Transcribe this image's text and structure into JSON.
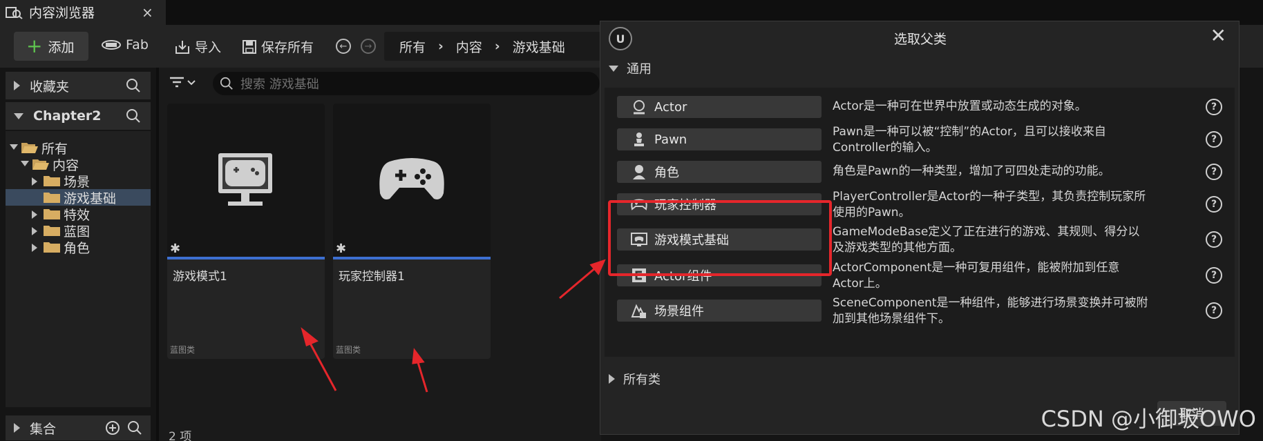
{
  "tab": {
    "title": "内容浏览器",
    "close": "×"
  },
  "toolbar": {
    "add_label": "添加",
    "fab_label": "Fab",
    "import_label": "导入",
    "save_all_label": "保存所有",
    "breadcrumb": [
      "所有",
      "内容",
      "游戏基础"
    ]
  },
  "sidebar": {
    "favorites": "收藏夹",
    "project": "Chapter2",
    "tree": [
      {
        "label": "所有",
        "level": 0,
        "expanded": true,
        "selected": false
      },
      {
        "label": "内容",
        "level": 1,
        "expanded": true,
        "selected": false
      },
      {
        "label": "场景",
        "level": 2,
        "expanded": false,
        "selected": false
      },
      {
        "label": "游戏基础",
        "level": 2,
        "expanded": false,
        "selected": true
      },
      {
        "label": "特效",
        "level": 2,
        "expanded": false,
        "selected": false
      },
      {
        "label": "蓝图",
        "level": 2,
        "expanded": false,
        "selected": false
      },
      {
        "label": "角色",
        "level": 2,
        "expanded": false,
        "selected": false
      }
    ],
    "collections": "集合"
  },
  "content": {
    "search_placeholder": "搜索 游戏基础",
    "assets": [
      {
        "name": "游戏模式1",
        "type": "蓝图类",
        "icon": "monitor-gamepad-icon"
      },
      {
        "name": "玩家控制器1",
        "type": "蓝图类",
        "icon": "gamepad-icon"
      }
    ],
    "item_count": "2 项"
  },
  "dialog": {
    "title": "选取父类",
    "common_section": "通用",
    "all_classes_section": "所有类",
    "cancel_label": "取消",
    "classes": [
      {
        "label": "Actor",
        "icon": "actor-icon",
        "desc_lines": [
          "Actor是一种可在世界中放置或动态生成的对象。"
        ]
      },
      {
        "label": "Pawn",
        "icon": "pawn-icon",
        "desc_lines": [
          "Pawn是一种可以被“控制”的Actor，且可以接收来自",
          "Controller的输入。"
        ]
      },
      {
        "label": "角色",
        "icon": "character-icon",
        "desc_lines": [
          "角色是Pawn的一种类型，增加了可四处走动的功能。"
        ]
      },
      {
        "label": "玩家控制器",
        "icon": "gamepad-icon",
        "desc_lines": [
          "PlayerController是Actor的一种子类型，其负责控制玩家所",
          "使用的Pawn。"
        ]
      },
      {
        "label": "游戏模式基础",
        "icon": "monitor-gamepad-icon",
        "desc_lines": [
          "GameModeBase定义了正在进行的游戏、其规则、得分以",
          "及游戏类型的其他方面。"
        ]
      },
      {
        "label": "Actor组件",
        "icon": "component-icon",
        "desc_lines": [
          "ActorComponent是一种可复用组件，能被附加到任意",
          "Actor上。"
        ]
      },
      {
        "label": "场景组件",
        "icon": "scene-component-icon",
        "desc_lines": [
          "SceneComponent是一种组件，能够进行场景变换并可被附",
          "加到其他场景组件下。"
        ]
      }
    ]
  },
  "watermark": "CSDN @小御坂OWO",
  "colors": {
    "accent_blue": "#3d6fd1",
    "add_green": "#5fc44f",
    "annotation_red": "#e5262b",
    "selected_row": "#3a4a5e"
  }
}
